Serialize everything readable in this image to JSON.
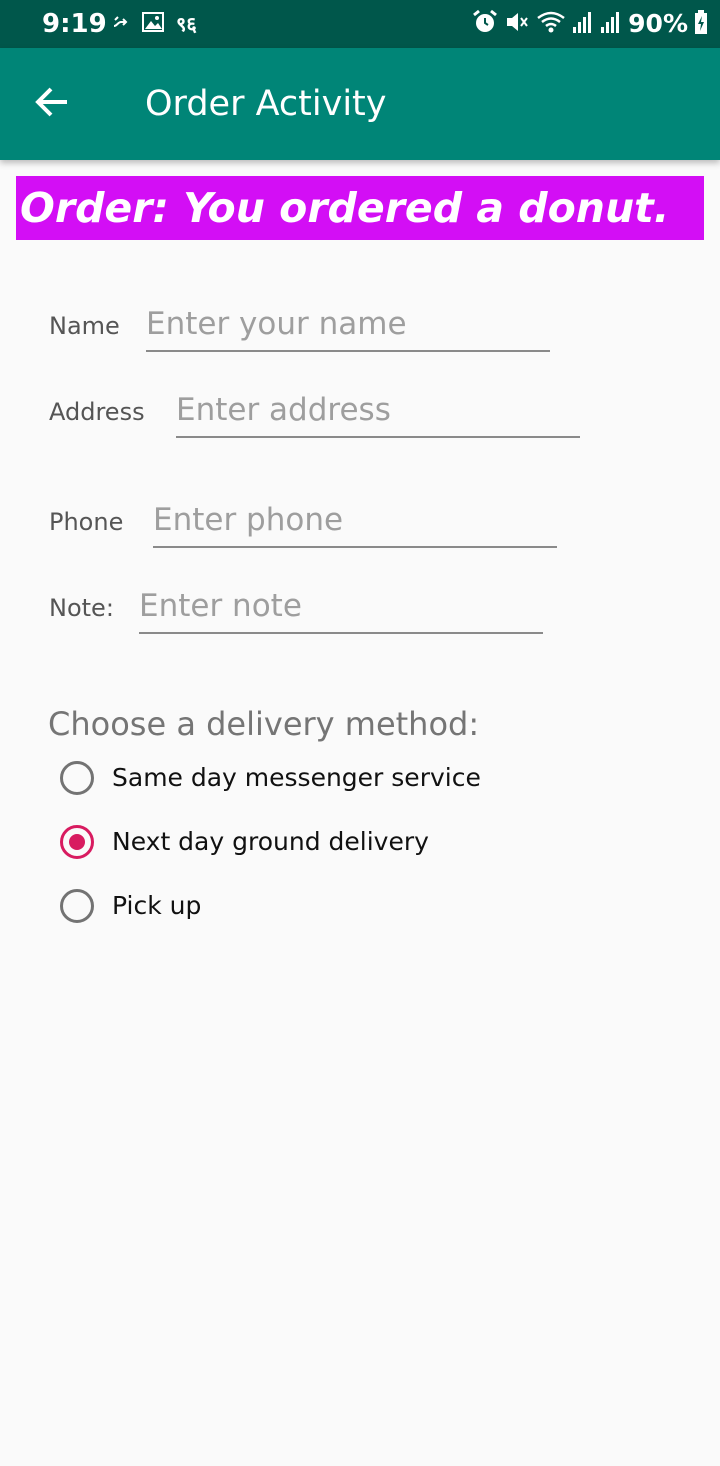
{
  "status_bar": {
    "time": "9:19",
    "left_icons": [
      "sync-icon",
      "image-icon",
      "notification-text-icon"
    ],
    "notification_text": "९६",
    "right_icons": [
      "alarm-icon",
      "mute-icon",
      "wifi-icon",
      "signal-icon",
      "signal-icon",
      "battery-icon"
    ],
    "battery": "90%",
    "background": "#00574b"
  },
  "app_bar": {
    "title": "Order Activity",
    "back_icon": "arrow-left-icon",
    "background": "#008577"
  },
  "order": {
    "text": "Order: You ordered a donut.",
    "background": "#d30ef5"
  },
  "form": {
    "name": {
      "label": "Name",
      "placeholder": "Enter your name",
      "value": ""
    },
    "address": {
      "label": "Address",
      "placeholder": "Enter address",
      "value": ""
    },
    "phone": {
      "label": "Phone",
      "placeholder": "Enter phone",
      "value": ""
    },
    "note": {
      "label": "Note:",
      "placeholder": "Enter note",
      "value": ""
    }
  },
  "delivery": {
    "heading": "Choose a delivery method:",
    "options": [
      {
        "label": "Same day messenger service",
        "checked": false
      },
      {
        "label": "Next day ground delivery",
        "checked": true
      },
      {
        "label": "Pick up",
        "checked": false
      }
    ],
    "accent": "#d81b60"
  }
}
